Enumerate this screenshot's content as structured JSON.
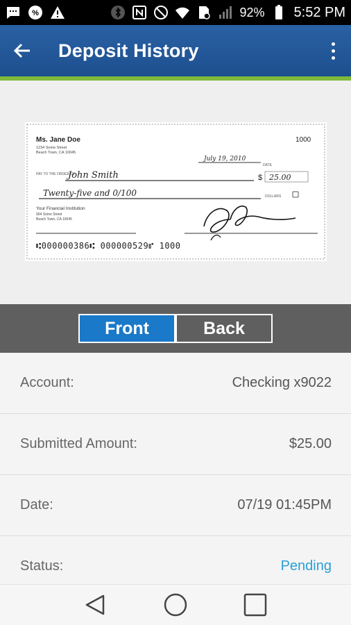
{
  "status_bar": {
    "battery": "92%",
    "time": "5:52 PM",
    "icons": [
      "message-icon",
      "percent-icon",
      "warning-icon",
      "bluetooth-icon",
      "nfc-icon",
      "mute-icon",
      "wifi-icon",
      "sim-icon",
      "signal-icon",
      "battery-icon"
    ]
  },
  "app_bar": {
    "title": "Deposit History",
    "back_icon": "arrow-back-icon",
    "menu_icon": "overflow-menu-icon",
    "background": "#1d4f8e",
    "accent": "#7fba3c"
  },
  "check": {
    "payer_name": "Ms. Jane Doe",
    "payer_address_1": "1234 Some Street",
    "payer_address_2": "Beach Town, CA 10045",
    "check_number": "1000",
    "date": "July 19, 2010",
    "date_caption": "DATE",
    "pay_to_caption": "PAY TO THE ORDER OF",
    "payee": "John Smith",
    "amount_numeric": "25.00",
    "amount_words": "Twenty-five and 0/100",
    "dollars_caption": "DOLLARS",
    "bank_name": "Your Financial Institution",
    "bank_address_1": "904 Some Street",
    "bank_address_2": "Beach Town, CA 10045",
    "micr": "⑆000000386⑆  000000529⑈  1000"
  },
  "toggle": {
    "front_label": "Front",
    "back_label": "Back",
    "selected": "Front",
    "selected_color": "#1a79c9"
  },
  "details": [
    {
      "label": "Account:",
      "value": "Checking x9022"
    },
    {
      "label": "Submitted Amount:",
      "value": "$25.00"
    },
    {
      "label": "Date:",
      "value": "07/19 01:45PM"
    },
    {
      "label": "Status:",
      "value": "Pending",
      "value_color": "#2a9fd6"
    }
  ],
  "nav": {
    "icons": [
      "back-triangle-icon",
      "home-circle-icon",
      "recents-square-icon"
    ]
  }
}
